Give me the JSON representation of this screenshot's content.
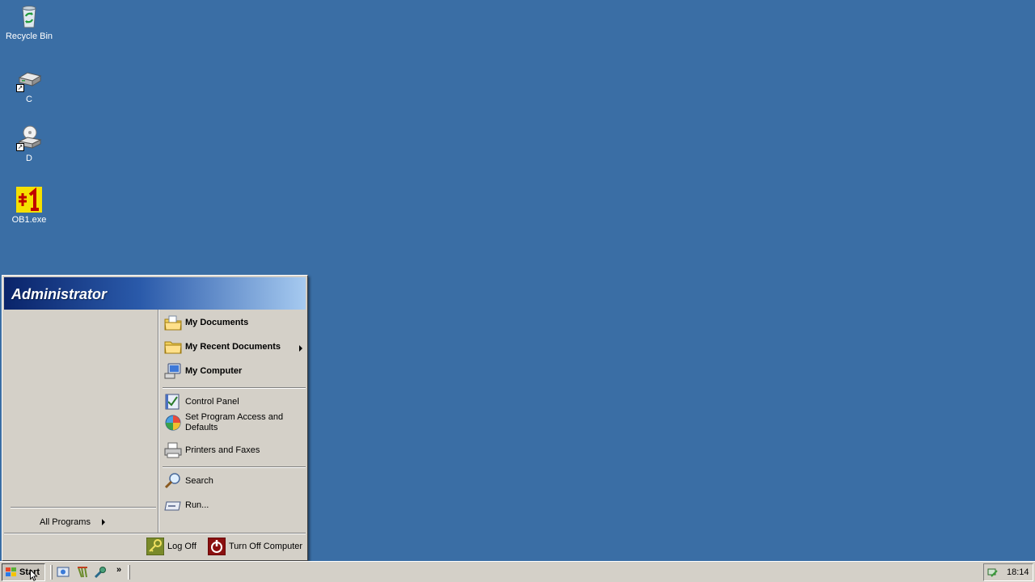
{
  "desktop": {
    "icons": [
      {
        "name": "recycle-bin",
        "label": "Recycle Bin"
      },
      {
        "name": "drive-c",
        "label": "C"
      },
      {
        "name": "drive-d",
        "label": "D"
      },
      {
        "name": "ob1-exe",
        "label": "OB1.exe"
      }
    ],
    "background_color": "#3a6ea5"
  },
  "start_menu": {
    "user_name": "Administrator",
    "all_programs_label": "All Programs",
    "right_items": [
      {
        "label": "My Documents",
        "icon": "my-documents-icon"
      },
      {
        "label": "My Recent Documents",
        "icon": "folder-icon",
        "has_submenu": true
      },
      {
        "label": "My Computer",
        "icon": "my-computer-icon"
      },
      {
        "label": "Control Panel",
        "icon": "control-panel-icon"
      },
      {
        "label": "Set Program Access and Defaults",
        "icon": "program-access-icon"
      },
      {
        "label": "Printers and Faxes",
        "icon": "printer-icon"
      },
      {
        "label": "Search",
        "icon": "search-icon"
      },
      {
        "label": "Run...",
        "icon": "run-icon"
      }
    ],
    "footer": {
      "log_off_label": "Log Off",
      "turn_off_label": "Turn Off Computer"
    }
  },
  "taskbar": {
    "start_label": "Start",
    "quick_launch": [
      "show-desktop-icon",
      "internet-explorer-icon",
      "tools-icon"
    ],
    "more_label": "»",
    "clock": "18:14"
  }
}
